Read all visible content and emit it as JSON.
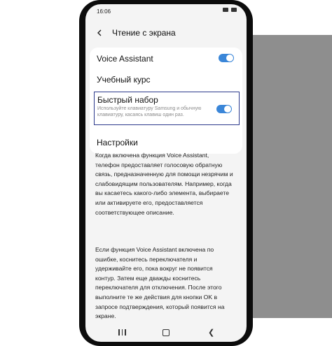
{
  "status": {
    "time": "16:06"
  },
  "header": {
    "title": "Чтение с экрана",
    "back_icon": "chevron-left-icon"
  },
  "settings": {
    "voice_assistant": {
      "label": "Voice Assistant",
      "enabled": true
    },
    "tutorial": {
      "label": "Учебный курс"
    },
    "quick_typing": {
      "label": "Быстрый набор",
      "description": "Используйте клавиатуру Samsung и обычную клавиатуру, касаясь клавиш один раз.",
      "enabled": true
    },
    "settings_item": {
      "label": "Настройки"
    }
  },
  "info": {
    "paragraph1": "Когда включена функция Voice Assistant, телефон предоставляет голосовую обратную связь, предназначенную для помощи незрячим и слабовидящим пользователям. Например, когда вы касаетесь какого-либо элемента, выбираете или активируете его, предоставляется соответствующее описание.",
    "paragraph2": "Если функция Voice Assistant включена по ошибке, коснитесь переключателя и удерживайте его, пока вокруг не появится контур. Затем еще дважды коснитесь переключателя для отключения. После этого выполните те же действия для кнопки OK в запросе подтверждения, который появится на экране."
  },
  "nav": {
    "recent_icon": "recent-apps-icon",
    "home_icon": "home-icon",
    "back_icon": "back-icon"
  },
  "colors": {
    "accent": "#3a86d8",
    "highlight_border": "#2d3a8c"
  }
}
